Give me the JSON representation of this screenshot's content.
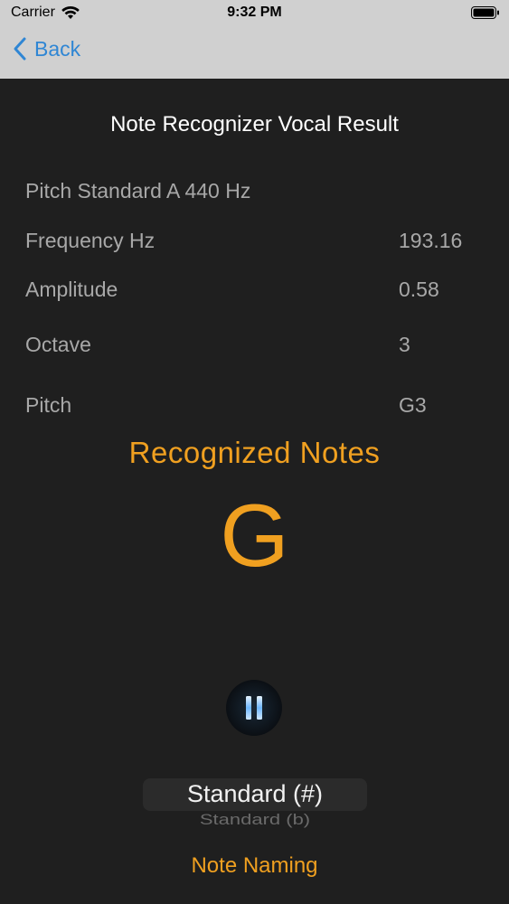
{
  "status_bar": {
    "carrier": "Carrier",
    "time": "9:32 PM"
  },
  "nav": {
    "back_label": "Back"
  },
  "title": "Note Recognizer Vocal Result",
  "rows": [
    {
      "label": "Pitch Standard A 440 Hz",
      "value": ""
    },
    {
      "label": "Frequency Hz",
      "value": "193.16"
    },
    {
      "label": "Amplitude",
      "value": "0.58"
    },
    {
      "label": "Octave",
      "value": "3"
    },
    {
      "label": "Pitch",
      "value": "G3"
    }
  ],
  "recognized": {
    "title": "Recognized Notes",
    "note": "G"
  },
  "picker": {
    "selected": "Standard (#)",
    "next": "Standard (b)"
  },
  "note_naming_label": "Note Naming",
  "colors": {
    "accent": "#f0a020",
    "link": "#2f86d4",
    "background": "#1f1f1f",
    "nav_background": "#d0d0d0"
  },
  "icons": {
    "wifi": "wifi-icon",
    "battery": "battery-icon",
    "back": "chevron-left-icon",
    "pause": "pause-icon"
  }
}
